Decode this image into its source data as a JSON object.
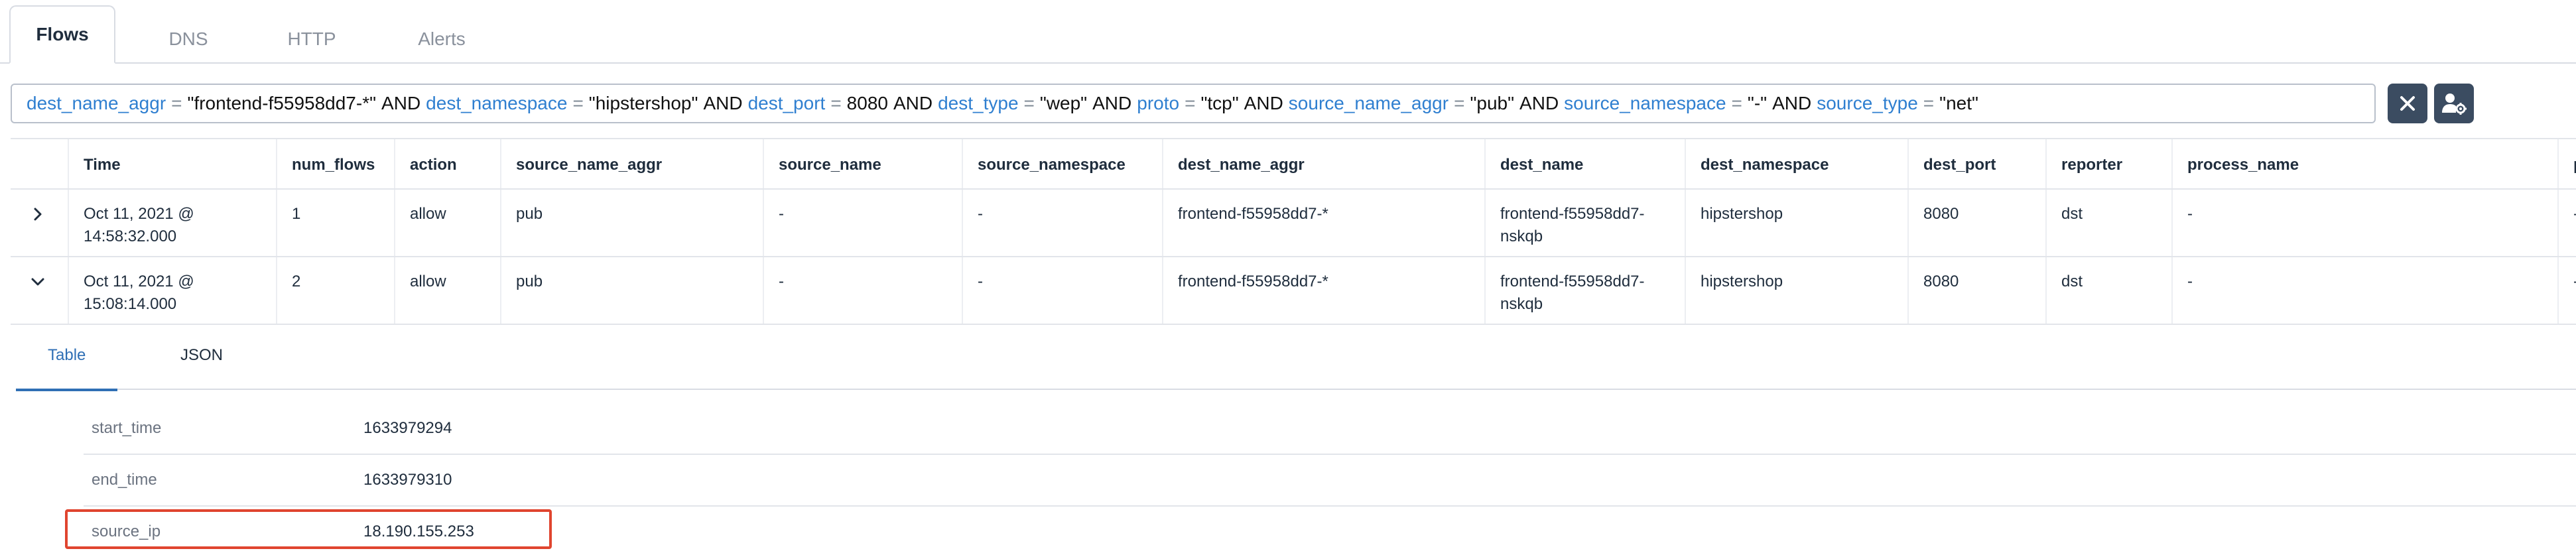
{
  "tabs": [
    {
      "label": "Flows"
    },
    {
      "label": "DNS"
    },
    {
      "label": "HTTP"
    },
    {
      "label": "Alerts"
    }
  ],
  "query": {
    "clauses": [
      {
        "key": "dest_name_aggr",
        "op": "=",
        "value": "\"frontend-f55958dd7-*\""
      },
      {
        "key": "dest_namespace",
        "op": "=",
        "value": "\"hipstershop\""
      },
      {
        "key": "dest_port",
        "op": "=",
        "value": "8080"
      },
      {
        "key": "dest_type",
        "op": "=",
        "value": "\"wep\""
      },
      {
        "key": "proto",
        "op": "=",
        "value": "\"tcp\""
      },
      {
        "key": "source_name_aggr",
        "op": "=",
        "value": "\"pub\""
      },
      {
        "key": "source_namespace",
        "op": "=",
        "value": "\"-\""
      },
      {
        "key": "source_type",
        "op": "=",
        "value": "\"net\""
      }
    ],
    "joiner": "AND"
  },
  "buttons": {
    "clear_icon": "close-icon",
    "settings_icon": "user-settings-icon"
  },
  "table": {
    "columns": [
      "",
      "Time",
      "num_flows",
      "action",
      "source_name_aggr",
      "source_name",
      "source_namespace",
      "dest_name_aggr",
      "dest_name",
      "dest_namespace",
      "dest_port",
      "reporter",
      "process_name",
      "p"
    ],
    "rows": [
      {
        "expanded": false,
        "cells": [
          "",
          "Oct 11, 2021 @ 14:58:32.000",
          "1",
          "allow",
          "pub",
          "-",
          "-",
          "frontend-f55958dd7-*",
          "frontend-f55958dd7-\nnskqb",
          "hipstershop",
          "8080",
          "dst",
          "-",
          "-"
        ]
      },
      {
        "expanded": true,
        "cells": [
          "",
          "Oct 11, 2021 @ 15:08:14.000",
          "2",
          "allow",
          "pub",
          "-",
          "-",
          "frontend-f55958dd7-*",
          "frontend-f55958dd7-\nnskqb",
          "hipstershop",
          "8080",
          "dst",
          "-",
          "-"
        ]
      }
    ]
  },
  "detail": {
    "tabs": [
      {
        "label": "Table"
      },
      {
        "label": "JSON"
      }
    ],
    "fields": [
      {
        "key": "start_time",
        "value": "1633979294"
      },
      {
        "key": "end_time",
        "value": "1633979310"
      },
      {
        "key": "source_ip",
        "value": "18.190.155.253"
      }
    ]
  },
  "colors": {
    "query_key": "#2f7fd0",
    "highlight": "#e0452f",
    "active_subtab": "#2f6fb5",
    "button_bg": "#3b4c61"
  }
}
